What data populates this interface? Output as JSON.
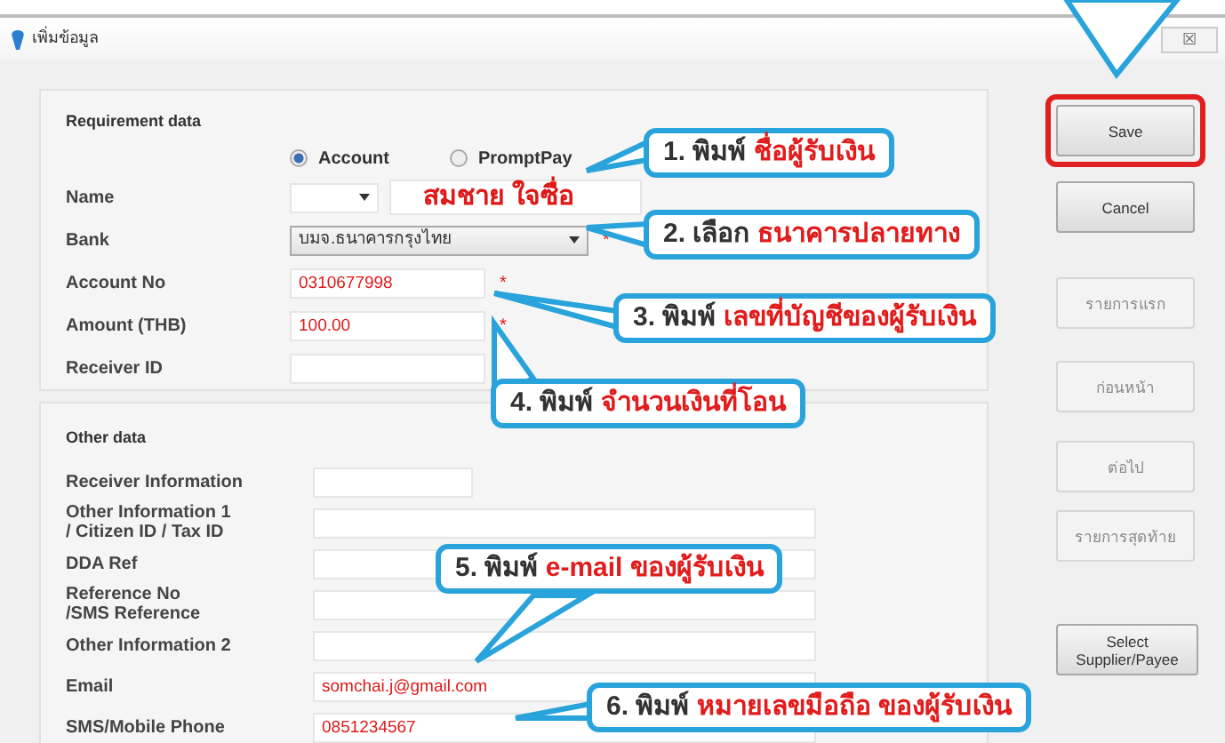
{
  "window": {
    "title": "เพิ่มข้อมูล",
    "close": "☒"
  },
  "requirement": {
    "title": "Requirement data",
    "radios": [
      {
        "label": "Account",
        "selected": true
      },
      {
        "label": "PromptPay",
        "selected": false
      }
    ],
    "fields": [
      {
        "label": "Name",
        "kind": "name",
        "value": "สมชาย  ใจซื่อ"
      },
      {
        "label": "Bank",
        "kind": "combo",
        "value": "บมจ.ธนาคารกรุงไทย",
        "marker": "*"
      },
      {
        "label": "Account No",
        "kind": "text",
        "value": "0310677998",
        "marker": "*"
      },
      {
        "label": "Amount (THB)",
        "kind": "text",
        "value": "100.00",
        "marker": "*"
      },
      {
        "label": "Receiver ID",
        "kind": "text"
      }
    ]
  },
  "other": {
    "title": "Other data",
    "fields": [
      {
        "label": "Receiver Information",
        "kind": "short"
      },
      {
        "label": "Other Information 1\n/ Citizen ID / Tax ID",
        "kind": "long"
      },
      {
        "label": "DDA Ref",
        "kind": "long"
      },
      {
        "label": "Reference No\n/SMS Reference",
        "kind": "long"
      },
      {
        "label": "Other Information 2",
        "kind": "long"
      },
      {
        "label": "Email",
        "kind": "long",
        "value": "somchai.j@gmail.com"
      },
      {
        "label": "SMS/Mobile Phone",
        "kind": "long",
        "value": "0851234567"
      }
    ]
  },
  "buttons": [
    {
      "label": "Save",
      "disabled": false,
      "highlighted": true
    },
    {
      "label": "Cancel",
      "disabled": false,
      "highlighted": false
    },
    {
      "label": "รายการแรก",
      "disabled": true,
      "highlighted": false
    },
    {
      "label": "ก่อนหน้า",
      "disabled": true,
      "highlighted": false
    },
    {
      "label": "ต่อไป",
      "disabled": true,
      "highlighted": false
    },
    {
      "label": "รายการสุดท้าย",
      "disabled": true,
      "highlighted": false
    },
    {
      "label": "Select Supplier/Payee",
      "disabled": false,
      "highlighted": false
    }
  ],
  "callouts": [
    {
      "prefix": "1. พิมพ์",
      "highlight": "ชื่อผู้รับเงิน"
    },
    {
      "prefix": "2. เลือก",
      "highlight": "ธนาคารปลายทาง"
    },
    {
      "prefix": "3. พิมพ์",
      "highlight": "เลขที่บัญชีของผู้รับเงิน"
    },
    {
      "prefix": "4. พิมพ์",
      "highlight": "จำนวนเงินที่โอน"
    },
    {
      "prefix": "5. พิมพ์",
      "highlight": "e-mail ของผู้รับเงิน"
    },
    {
      "prefix": "6. พิมพ์",
      "highlight": "หมายเลขมือถือ ของผู้รับเงิน"
    }
  ]
}
